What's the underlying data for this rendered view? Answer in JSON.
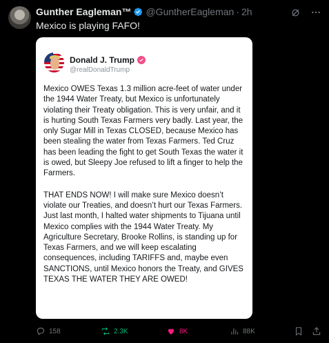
{
  "tweet": {
    "author_name": "Gunther Eagleman™",
    "handle": "@GuntherEagleman",
    "separator": "·",
    "time": "2h",
    "text": "Mexico is playing FAFO!"
  },
  "embedded_post": {
    "author_name": "Donald J. Trump",
    "handle": "@realDonaldTrump",
    "paragraphs": [
      "Mexico OWES Texas 1.3 million acre-feet of water under the 1944 Water Treaty, but Mexico is unfortunately violating their Treaty obligation. This is very unfair, and it is hurting South Texas Farmers very badly. Last year, the only Sugar Mill in Texas CLOSED, because Mexico has been stealing the water from Texas Farmers. Ted Cruz has been leading the fight to get South Texas the water it is owed, but Sleepy Joe refused to lift a finger to help the Farmers.",
      "THAT ENDS NOW! I will make sure Mexico doesn’t violate our Treaties, and doesn’t hurt our Texas Farmers. Just last month, I halted water shipments to Tijuana until Mexico complies with the 1944 Water Treaty. My Agriculture Secretary, Brooke Rollins, is standing up for Texas Farmers, and we will keep escalating consequences, including TARIFFS and, maybe even SANCTIONS, until Mexico honors the Treaty, and GIVES TEXAS THE WATER THEY ARE OWED!"
    ]
  },
  "actions": {
    "replies": "158",
    "reposts": "2.3K",
    "likes": "8K",
    "views": "88K"
  },
  "colors": {
    "background": "#000000",
    "verified_blue": "#1d9bf0",
    "repost_green": "#00ba7c",
    "like_pink": "#f91880",
    "muted": "#71767b"
  },
  "icons": [
    "verified-badge-icon",
    "grok-icon",
    "more-icon",
    "reply-icon",
    "repost-icon",
    "like-icon",
    "views-icon",
    "bookmark-icon",
    "share-icon"
  ]
}
